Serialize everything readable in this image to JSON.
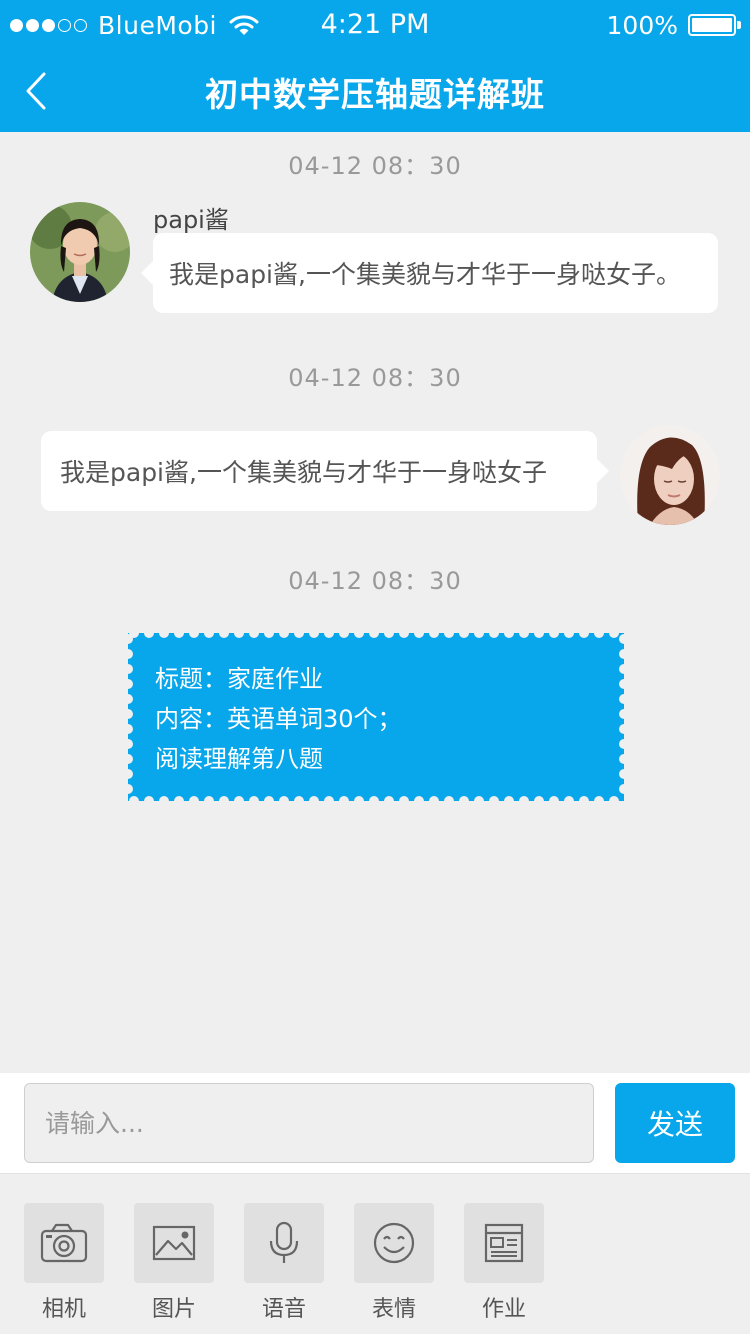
{
  "status_bar": {
    "carrier": "BlueMobi",
    "time": "4:21 PM",
    "battery": "100%"
  },
  "nav": {
    "title": "初中数学压轴题详解班",
    "back_icon": "chevron-left-icon"
  },
  "colors": {
    "accent": "#08a6ea",
    "background": "#efefef"
  },
  "chat": {
    "messages": [
      {
        "timestamp": "04-12   08：30",
        "sender": "papi酱",
        "side": "left",
        "text": "我是papi酱,一个集美貌与才华于一身哒女子。"
      },
      {
        "timestamp": "04-12   08：30",
        "side": "right",
        "text": "我是papi酱,一个集美貌与才华于一身哒女子"
      },
      {
        "timestamp": "04-12   08：30",
        "type": "homework",
        "lines": [
          "标题：家庭作业",
          "内容：英语单词30个；",
          "阅读理解第八题"
        ]
      }
    ]
  },
  "input_bar": {
    "placeholder": "请输入...",
    "send_label": "发送"
  },
  "toolbar": {
    "items": [
      {
        "label": "相机",
        "icon": "camera-icon"
      },
      {
        "label": "图片",
        "icon": "image-icon"
      },
      {
        "label": "语音",
        "icon": "microphone-icon"
      },
      {
        "label": "表情",
        "icon": "smiley-icon"
      },
      {
        "label": "作业",
        "icon": "homework-icon"
      }
    ]
  }
}
